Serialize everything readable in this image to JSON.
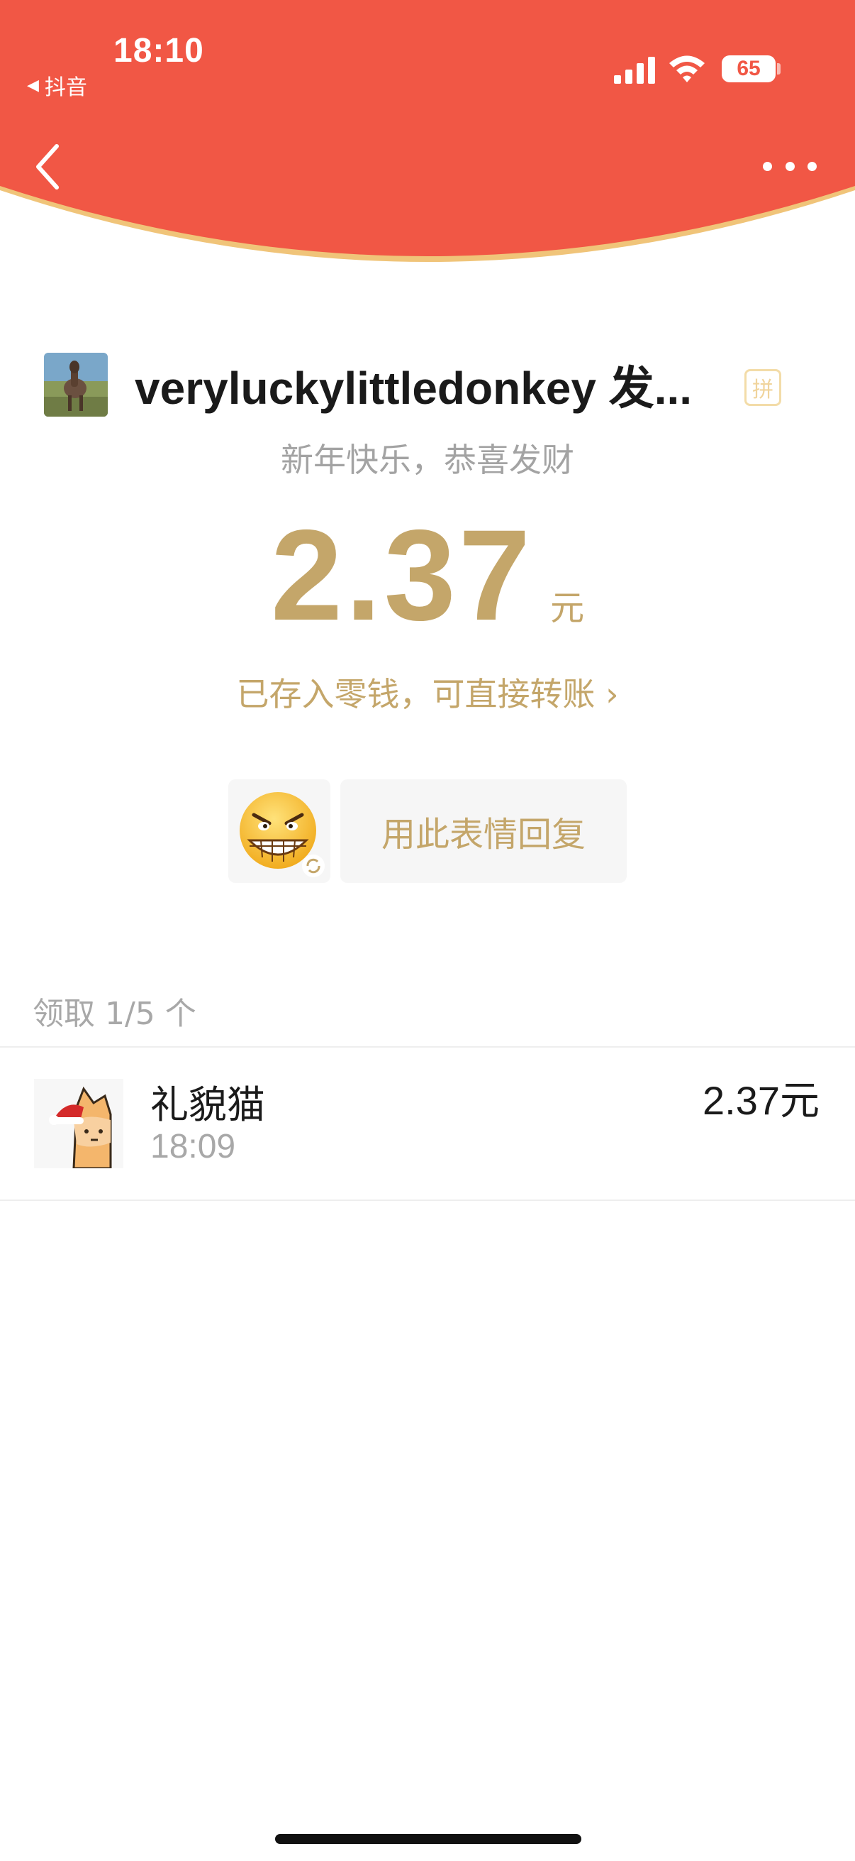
{
  "status_bar": {
    "time": "18:10",
    "back_app": "抖音",
    "battery": "65"
  },
  "colors": {
    "header_red": "#f15745",
    "header_edge": "#f0c479",
    "gold": "#c4a66a"
  },
  "envelope": {
    "sender": "veryluckylittledonkey 发...",
    "badge": "拼",
    "greeting": "新年快乐，恭喜发财",
    "amount": "2.37",
    "unit": "元",
    "wallet_link": "已存入零钱，可直接转账 ›"
  },
  "reply": {
    "button_label": "用此表情回复",
    "emoji": "grinning-face"
  },
  "claims": {
    "summary": "领取 1/5 个",
    "records": [
      {
        "name": "礼貌猫",
        "time": "18:09",
        "amount": "2.37元"
      }
    ]
  }
}
